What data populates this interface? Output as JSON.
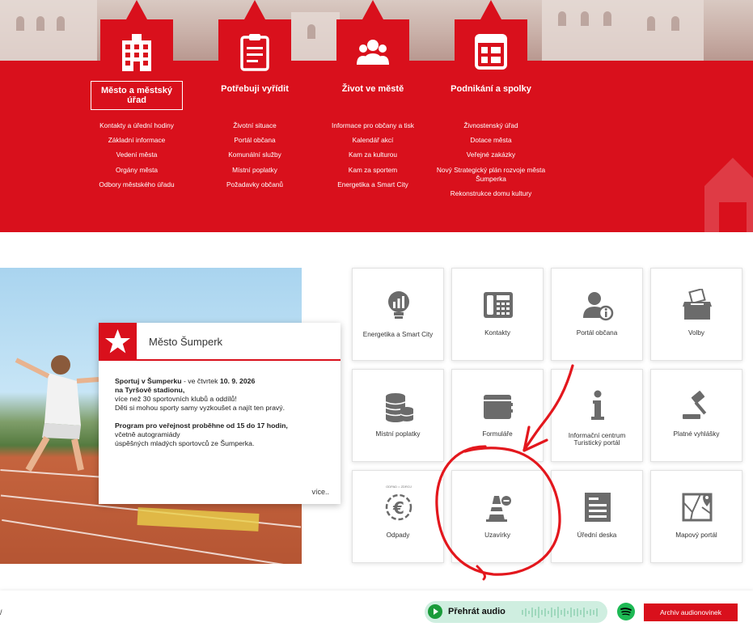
{
  "colors": {
    "brand_red": "#d9101c",
    "icon_gray": "#6b6b6b",
    "annotation_red": "#e3171d",
    "audio_green": "#1a9b3a"
  },
  "main_menu": [
    {
      "title": "Město a městský úřad",
      "icon": "town-hall-icon",
      "active": true,
      "links": [
        "Kontakty a úřední hodiny",
        "Základní informace",
        "Vedení města",
        "Orgány města",
        "Odbory městského úřadu"
      ]
    },
    {
      "title": "Potřebuji vyřídit",
      "icon": "clipboard-icon",
      "active": false,
      "links": [
        "Životní situace",
        "Portál občana",
        "Komunální služby",
        "Místní poplatky",
        "Požadavky občanů"
      ]
    },
    {
      "title": "Život ve městě",
      "icon": "people-icon",
      "active": false,
      "links": [
        "Informace pro občany a tisk",
        "Kalendář akcí",
        "Kam za kulturou",
        "Kam za sportem",
        "Energetika a Smart City"
      ]
    },
    {
      "title": "Podnikání a spolky",
      "icon": "calendar-grid-icon",
      "active": false,
      "links": [
        "Živnostenský úřad",
        "Dotace města",
        "Veřejné zakázky",
        "Nový Strategický plán rozvoje města Šumperka",
        "Rekonstrukce domu kultury"
      ]
    }
  ],
  "news": {
    "title": "Město Šumperk",
    "p1_line1_a": "Sportuj v Šumperku",
    "p1_line1_b": " - ve čtvrtek ",
    "p1_line1_c": "10. 9. 2026",
    "p1_line2": "na Tyršově stadionu,",
    "p1_line3": "více než 30 sportovních klubů a oddílů!",
    "p1_line4": "Děti si mohou sporty samy vyzkoušet a najít ten pravý.",
    "p2_line1": "Program pro veřejnost proběhne od 15 do 17 hodin,",
    "p2_line2": "včetně autogramiády",
    "p2_line3": "úspěšných mladých sportovců ze Šumperka.",
    "more": "více.."
  },
  "tiles": [
    {
      "label": "Energetika a Smart City",
      "icon": "lightbulb-chart-icon"
    },
    {
      "label": "Kontakty",
      "icon": "office-phone-icon"
    },
    {
      "label": "Portál občana",
      "icon": "user-info-icon"
    },
    {
      "label": "Volby",
      "icon": "ballot-box-icon"
    },
    {
      "label": "Místní poplatky",
      "icon": "coin-stack-icon"
    },
    {
      "label": "Formuláře",
      "icon": "binder-icon"
    },
    {
      "label": "Informační centrum Turistický portál",
      "icon": "info-icon"
    },
    {
      "label": "Platné vyhlášky",
      "icon": "gavel-icon"
    },
    {
      "label": "Odpady",
      "icon": "euro-recycle-icon",
      "badge": "ODPAD = ZDROJ"
    },
    {
      "label": "Uzavírky",
      "icon": "traffic-cone-icon"
    },
    {
      "label": "Úřední deska",
      "icon": "notice-board-icon"
    },
    {
      "label": "Mapový portál",
      "icon": "map-icon"
    }
  ],
  "audio": {
    "play_label": "Přehrát audio",
    "archive_label": "Archiv audionovinek",
    "spotify_icon": "spotify-icon"
  }
}
